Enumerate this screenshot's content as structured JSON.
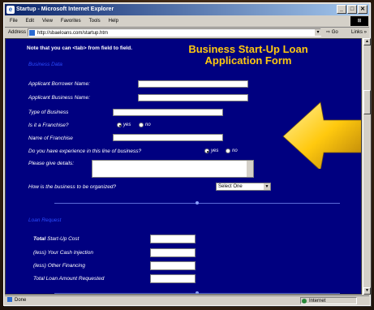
{
  "window": {
    "title": "Startup - Microsoft Internet Explorer",
    "buttons": {
      "minimize": "_",
      "maximize": "□",
      "close": "✕"
    }
  },
  "menu": {
    "items": [
      "File",
      "Edit",
      "View",
      "Favorites",
      "Tools",
      "Help"
    ]
  },
  "address": {
    "label": "Address",
    "url": "http://sbaeloans.com/startup.htm",
    "go": "Go",
    "links": "Links »"
  },
  "page": {
    "note": "Note that you can <tab> from field to field.",
    "headline_line1": "Business Start-Up Loan",
    "headline_line2": "Application Form",
    "section_business": "Business Data",
    "fields": {
      "borrower_name": "Applicant Borrower Name:",
      "business_name": "Applicant Business Name:",
      "type_of_business": "Type of Business",
      "is_franchise": "Is it a Franchise?",
      "name_of_franchise": "Name of Franchise",
      "experience": "Do you have experience in this line of business?",
      "details": "Please give details:",
      "organized": "How is the business to be organized?"
    },
    "radio": {
      "yes": "yes",
      "no": "no"
    },
    "select_value": "Select One",
    "section_loan": "Loan Request",
    "loan": {
      "total_bold": "Total",
      "total_rest": " Start-Up Cost",
      "cash": "(less) Your Cash Injection",
      "other": "(less) Other Financing",
      "requested": "Total Loan Amount Requested"
    }
  },
  "status": {
    "left": "Done",
    "zone": "Internet"
  },
  "colors": {
    "page_bg": "#000080",
    "headline": "#ffc90e",
    "section": "#2b4cff",
    "arrow": "#ffc90e"
  }
}
